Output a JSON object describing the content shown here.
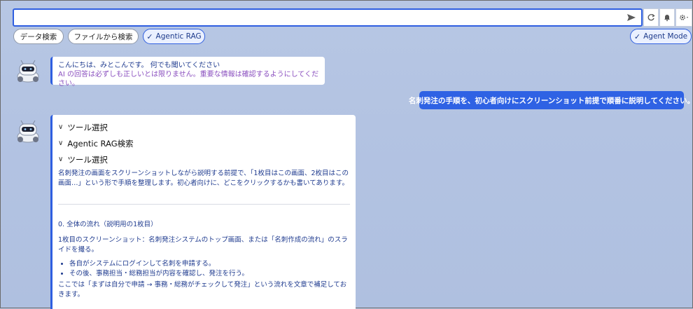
{
  "top": {
    "input_value": "",
    "pills": [
      "データ検索",
      "ファイルから検索",
      "Agentic RAG"
    ],
    "agent_mode": "Agent Mode"
  },
  "chat": {
    "bot_greeting_line1": "こんにちは、みとこんです。 何でも聞いてください",
    "bot_greeting_line2": "AI の回答は必ずしも正しいとは限りません。重要な情報は確認するようにしてください。",
    "user_message": "名刺発注の手順を、初心者向けにスクリーンショット前提で順番に説明してください。",
    "bot_sections": [
      "ツール選択",
      "Agentic RAG検索",
      "ツール選択"
    ],
    "intro": "名刺発注の画面をスクリーンショットしながら説明する前提で、「1枚目はこの画面、2枚目はこの画面…」という形で手順を整理します。初心者向けに、どこをクリックするかも書いてあります。",
    "heading0": "0. 全体の流れ（説明用の1枚目）",
    "shot1": "1枚目のスクリーンショット：名刺発注システムのトップ画面、または「名刺作成の流れ」のスライドを撮る。",
    "bullets": [
      "各自がシステムにログインして名刺を申請する。",
      "その後、事務担当・総務担当が内容を確認し、発注を行う。"
    ],
    "summary": "ここでは「まずは自分で申請 → 事務・総務がチェックして発注」という流れを文章で補足しておきます。"
  },
  "colors": {
    "accent": "#2f5fe0",
    "user_bubble": "#2f62e4",
    "text_blue": "#1f3b8f",
    "text_purple": "#8a4fbf"
  }
}
